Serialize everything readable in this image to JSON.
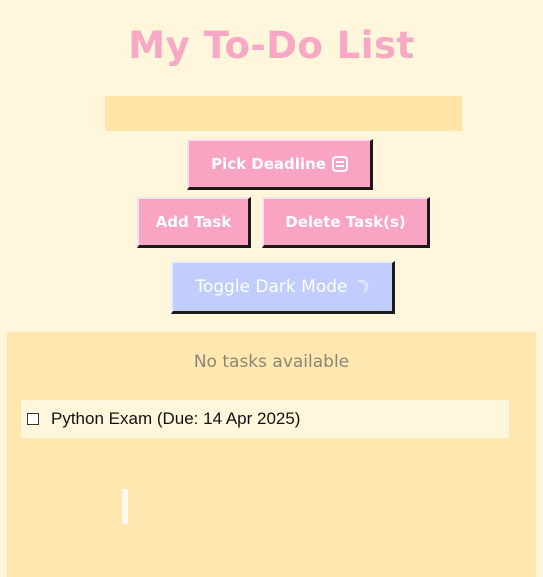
{
  "app": {
    "title": "My To-Do List"
  },
  "task_input": {
    "value": "",
    "placeholder": ""
  },
  "buttons": {
    "pick_deadline": "Pick Deadline",
    "add_task": "Add Task",
    "delete_tasks": "Delete Task(s)",
    "toggle_dark_mode": "Toggle Dark Mode"
  },
  "icons": {
    "deadline": "calendar-icon",
    "dark_mode": "moon-icon"
  },
  "task_list": {
    "empty_message": "No tasks available",
    "items": [
      {
        "label": "Python Exam (Due: 14 Apr 2025)",
        "checked": false
      }
    ]
  },
  "colors": {
    "background": "#fff6dc",
    "title": "#f7a8c4",
    "input": "#ffe6a8",
    "button_pink": "#f8a4c2",
    "button_blue": "#c1cdfd",
    "panel": "#ffe8b0"
  }
}
